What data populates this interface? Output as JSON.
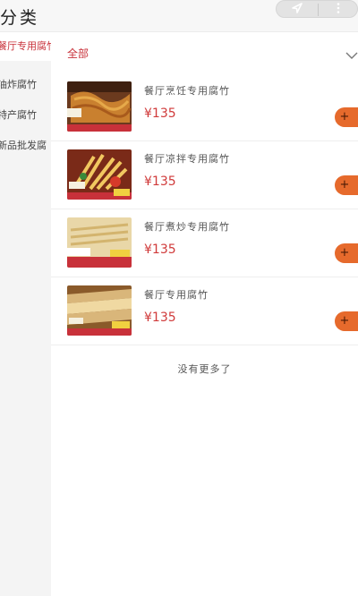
{
  "header": {
    "title": "分类",
    "capsule_left_icon": "location-arrow-icon",
    "capsule_right_icon": "more-dots-icon"
  },
  "sidebar": {
    "items": [
      {
        "label": "餐厅专用腐竹",
        "active": true
      },
      {
        "label": "油炸腐竹",
        "active": false
      },
      {
        "label": "特产腐竹",
        "active": false
      },
      {
        "label": "新品批发腐",
        "active": false
      }
    ]
  },
  "filter": {
    "label": "全部",
    "icon": "chevron-down-icon"
  },
  "products": [
    {
      "name": "餐厅烹饪专用腐竹",
      "price": "¥135",
      "add_label": "+"
    },
    {
      "name": "餐厅凉拌专用腐竹",
      "price": "¥135",
      "add_label": "+"
    },
    {
      "name": "餐厅煮炒专用腐竹",
      "price": "¥135",
      "add_label": "+"
    },
    {
      "name": "餐厅专用腐竹",
      "price": "¥135",
      "add_label": "+"
    }
  ],
  "footer": {
    "no_more_text": "没有更多了"
  },
  "colors": {
    "accent": "#c8313a",
    "price": "#d03a3a",
    "add_button": "#e66a2c",
    "sidebar_bg": "#f4f4f4"
  }
}
